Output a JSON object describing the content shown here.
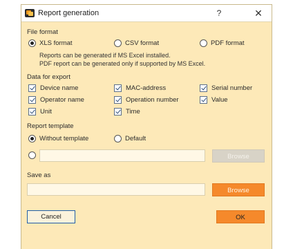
{
  "window": {
    "title": "Report generation",
    "help_label": "?",
    "close_label": "✕"
  },
  "file_format": {
    "label": "File format",
    "options": [
      "XLS format",
      "CSV format",
      "PDF format"
    ],
    "selected": "XLS format",
    "note_line1": "Reports can be generated if MS Excel installed.",
    "note_line2": "PDF report can be generated only if supported by MS Excel."
  },
  "data_for_export": {
    "label": "Data for export",
    "items": [
      {
        "label": "Device name",
        "checked": true
      },
      {
        "label": "MAC-address",
        "checked": true
      },
      {
        "label": "Serial number",
        "checked": true
      },
      {
        "label": "Operator name",
        "checked": true
      },
      {
        "label": "Operation number",
        "checked": true
      },
      {
        "label": "Value",
        "checked": true
      },
      {
        "label": "Unit",
        "checked": true
      },
      {
        "label": "Time",
        "checked": true
      }
    ]
  },
  "report_template": {
    "label": "Report template",
    "options": [
      "Without template",
      "Default"
    ],
    "selected": "Without template",
    "path_value": "",
    "browse_label": "Browse"
  },
  "save_as": {
    "label": "Save as",
    "path_value": "",
    "browse_label": "Browse"
  },
  "footer": {
    "cancel_label": "Cancel",
    "ok_label": "OK"
  },
  "colors": {
    "dialog_background": "#fde9b8",
    "accent_orange": "#f5892b",
    "disabled_button": "#d8d3c7",
    "focus_border": "#1f5fa8"
  }
}
